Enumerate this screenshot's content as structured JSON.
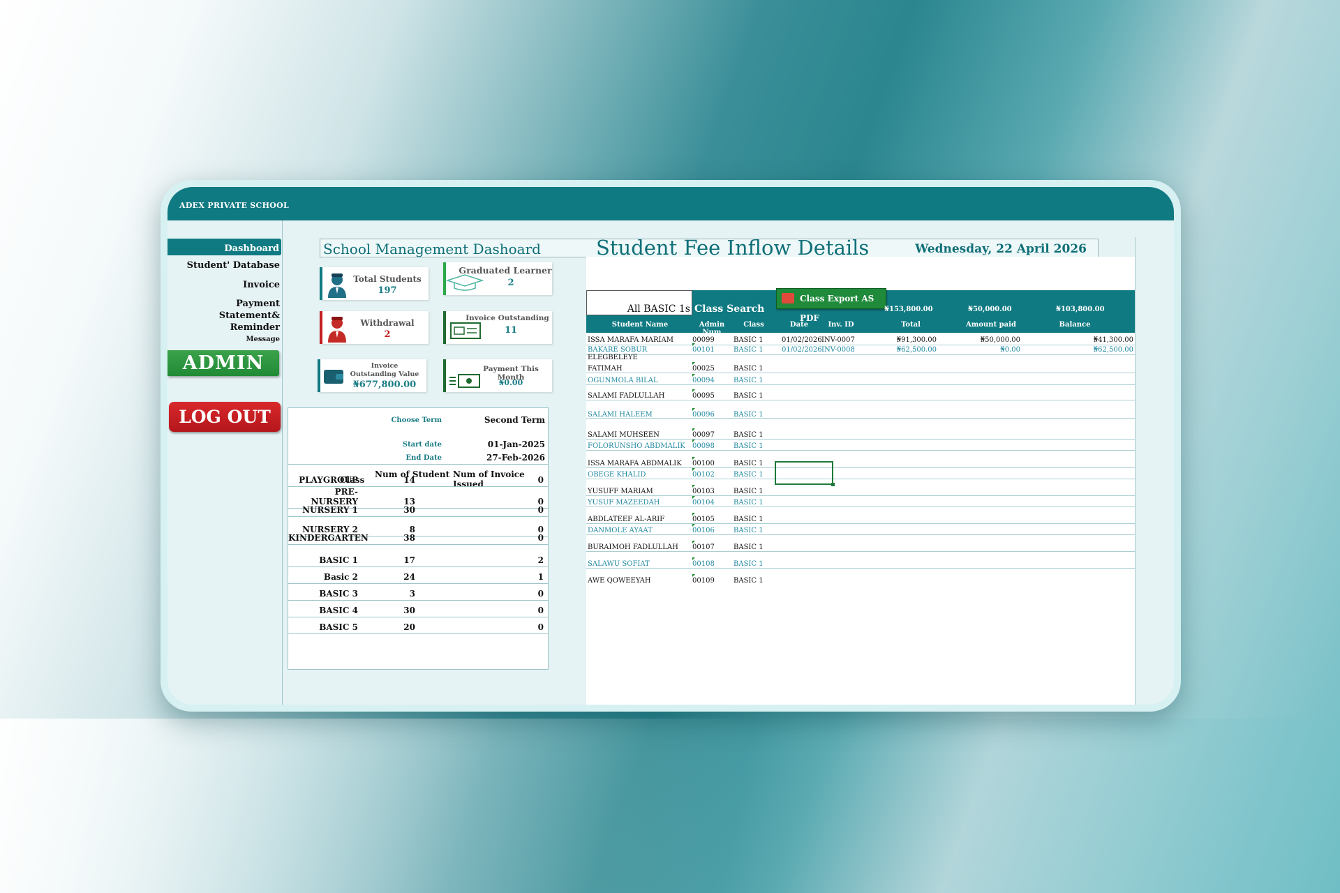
{
  "app": {
    "school_name": "ADEX PRIVATE SCHOOL"
  },
  "sidebar": {
    "items": [
      {
        "label": "Dashboard"
      },
      {
        "label": "Student' Database"
      },
      {
        "label": "Invoice"
      },
      {
        "label": "Payment"
      },
      {
        "label": "Statement& Reminder"
      },
      {
        "label": "Message"
      }
    ],
    "admin_label": "ADMIN",
    "logout_label": "LOG OUT"
  },
  "header": {
    "title": "School Management Dashoard",
    "date": "Wednesday, 22 April 2026"
  },
  "cards": {
    "total_students": {
      "label": "Total Students",
      "value": "197"
    },
    "graduated": {
      "label": "Graduated Learner",
      "value": "2"
    },
    "withdrawal": {
      "label": "Withdrawal",
      "value": "2"
    },
    "invoice_outstanding": {
      "label": "Invoice Outstanding",
      "value": "11"
    },
    "invoice_value": {
      "label_1": "Invoice",
      "label_2": "Outstanding Value",
      "value": "₦677,800.00"
    },
    "payment_month": {
      "label": "Payment This Month",
      "value": "₦0.00"
    }
  },
  "term": {
    "choose_label": "Choose Term",
    "choose_value": "Second Term",
    "start_label": "Start date",
    "start_value": "01-Jan-2025",
    "end_label": "End Date",
    "end_value": "27-Feb-2026",
    "headers": {
      "class": "Class",
      "num_student": "Num of Student",
      "num_invoice": "Num of Invoice Issued"
    },
    "rows": [
      {
        "class": "PLAYGROUP",
        "students": "14",
        "invoices": "0"
      },
      {
        "class": "PRE- NURSERY",
        "students": "13",
        "invoices": "0"
      },
      {
        "class": "NURSERY 1",
        "students": "30",
        "invoices": "0"
      },
      {
        "class": "NURSERY 2",
        "students": "8",
        "invoices": "0"
      },
      {
        "class": "KINDERGARTEN",
        "students": "38",
        "invoices": "0"
      },
      {
        "class": "BASIC 1",
        "students": "17",
        "invoices": "2"
      },
      {
        "class": "Basic 2",
        "students": "24",
        "invoices": "1"
      },
      {
        "class": "BASIC 3",
        "students": "3",
        "invoices": "0"
      },
      {
        "class": "BASIC 4",
        "students": "30",
        "invoices": "0"
      },
      {
        "class": "BASIC 5",
        "students": "20",
        "invoices": "0"
      }
    ]
  },
  "fee": {
    "title": "Student Fee Inflow Details",
    "class_input": "All BASIC 1s",
    "class_search": "Class Search",
    "export_label": "Class Export AS PDF",
    "totals": {
      "total": "₦153,800.00",
      "paid": "₦50,000.00",
      "balance": "₦103,800.00"
    },
    "headers": {
      "name": "Student Name",
      "admin": "Admin Num",
      "class": "Class",
      "date": "Date",
      "inv": "Inv. ID",
      "total": "Total",
      "paid": "Amount paid",
      "balance": "Balance"
    },
    "rows": [
      {
        "name": "ISSA MARAFA MARIAM",
        "admin": "00099",
        "class": "BASIC 1",
        "date": "01/02/2026",
        "inv": "INV-0007",
        "total": "₦91,300.00",
        "paid": "₦50,000.00",
        "balance": "₦41,300.00"
      },
      {
        "name": "BAKARE SOBUR",
        "admin": "00101",
        "class": "BASIC 1",
        "date": "01/02/2026",
        "inv": "INV-0008",
        "total": "₦62,500.00",
        "paid": "₦0.00",
        "balance": "₦62,500.00"
      },
      {
        "name": "ELEGBELEYE",
        "name2": "FATIMAH",
        "admin": "00025",
        "class": "BASIC 1"
      },
      {
        "name": "OGUNMOLA BILAL",
        "admin": "00094",
        "class": "BASIC 1"
      },
      {
        "name": "SALAMI FADLULLAH",
        "admin": "00095",
        "class": "BASIC 1"
      },
      {
        "name": "SALAMI HALEEM",
        "admin": "00096",
        "class": "BASIC 1"
      },
      {
        "name": "SALAMI MUHSEEN",
        "admin": "00097",
        "class": "BASIC 1"
      },
      {
        "name": "FOLORUNSHO ABDMALIK",
        "admin": "00098",
        "class": "BASIC 1"
      },
      {
        "name": "ISSA MARAFA ABDMALIK",
        "admin": "00100",
        "class": "BASIC 1"
      },
      {
        "name": "OBEGE KHALID",
        "admin": "00102",
        "class": "BASIC 1"
      },
      {
        "name": "YUSUFF MARIAM",
        "admin": "00103",
        "class": "BASIC 1"
      },
      {
        "name": "YUSUF MAZEEDAH",
        "admin": "00104",
        "class": "BASIC 1"
      },
      {
        "name": "ABDLATEEF AL-ARIF",
        "admin": "00105",
        "class": "BASIC 1"
      },
      {
        "name": "DANMOLE AYAAT",
        "admin": "00106",
        "class": "BASIC 1"
      },
      {
        "name": "BURAIMOH FADLULLAH",
        "admin": "00107",
        "class": "BASIC 1"
      },
      {
        "name": "SALAWU SOFIAT",
        "admin": "00108",
        "class": "BASIC 1"
      },
      {
        "name": "AWE QOWEEYAH",
        "admin": "00109",
        "class": "BASIC 1"
      }
    ]
  },
  "colors": {
    "primary": "#107a82",
    "accent_green": "#1f8a3a",
    "accent_red": "#c41e22",
    "teal_text": "#1f88a0"
  }
}
